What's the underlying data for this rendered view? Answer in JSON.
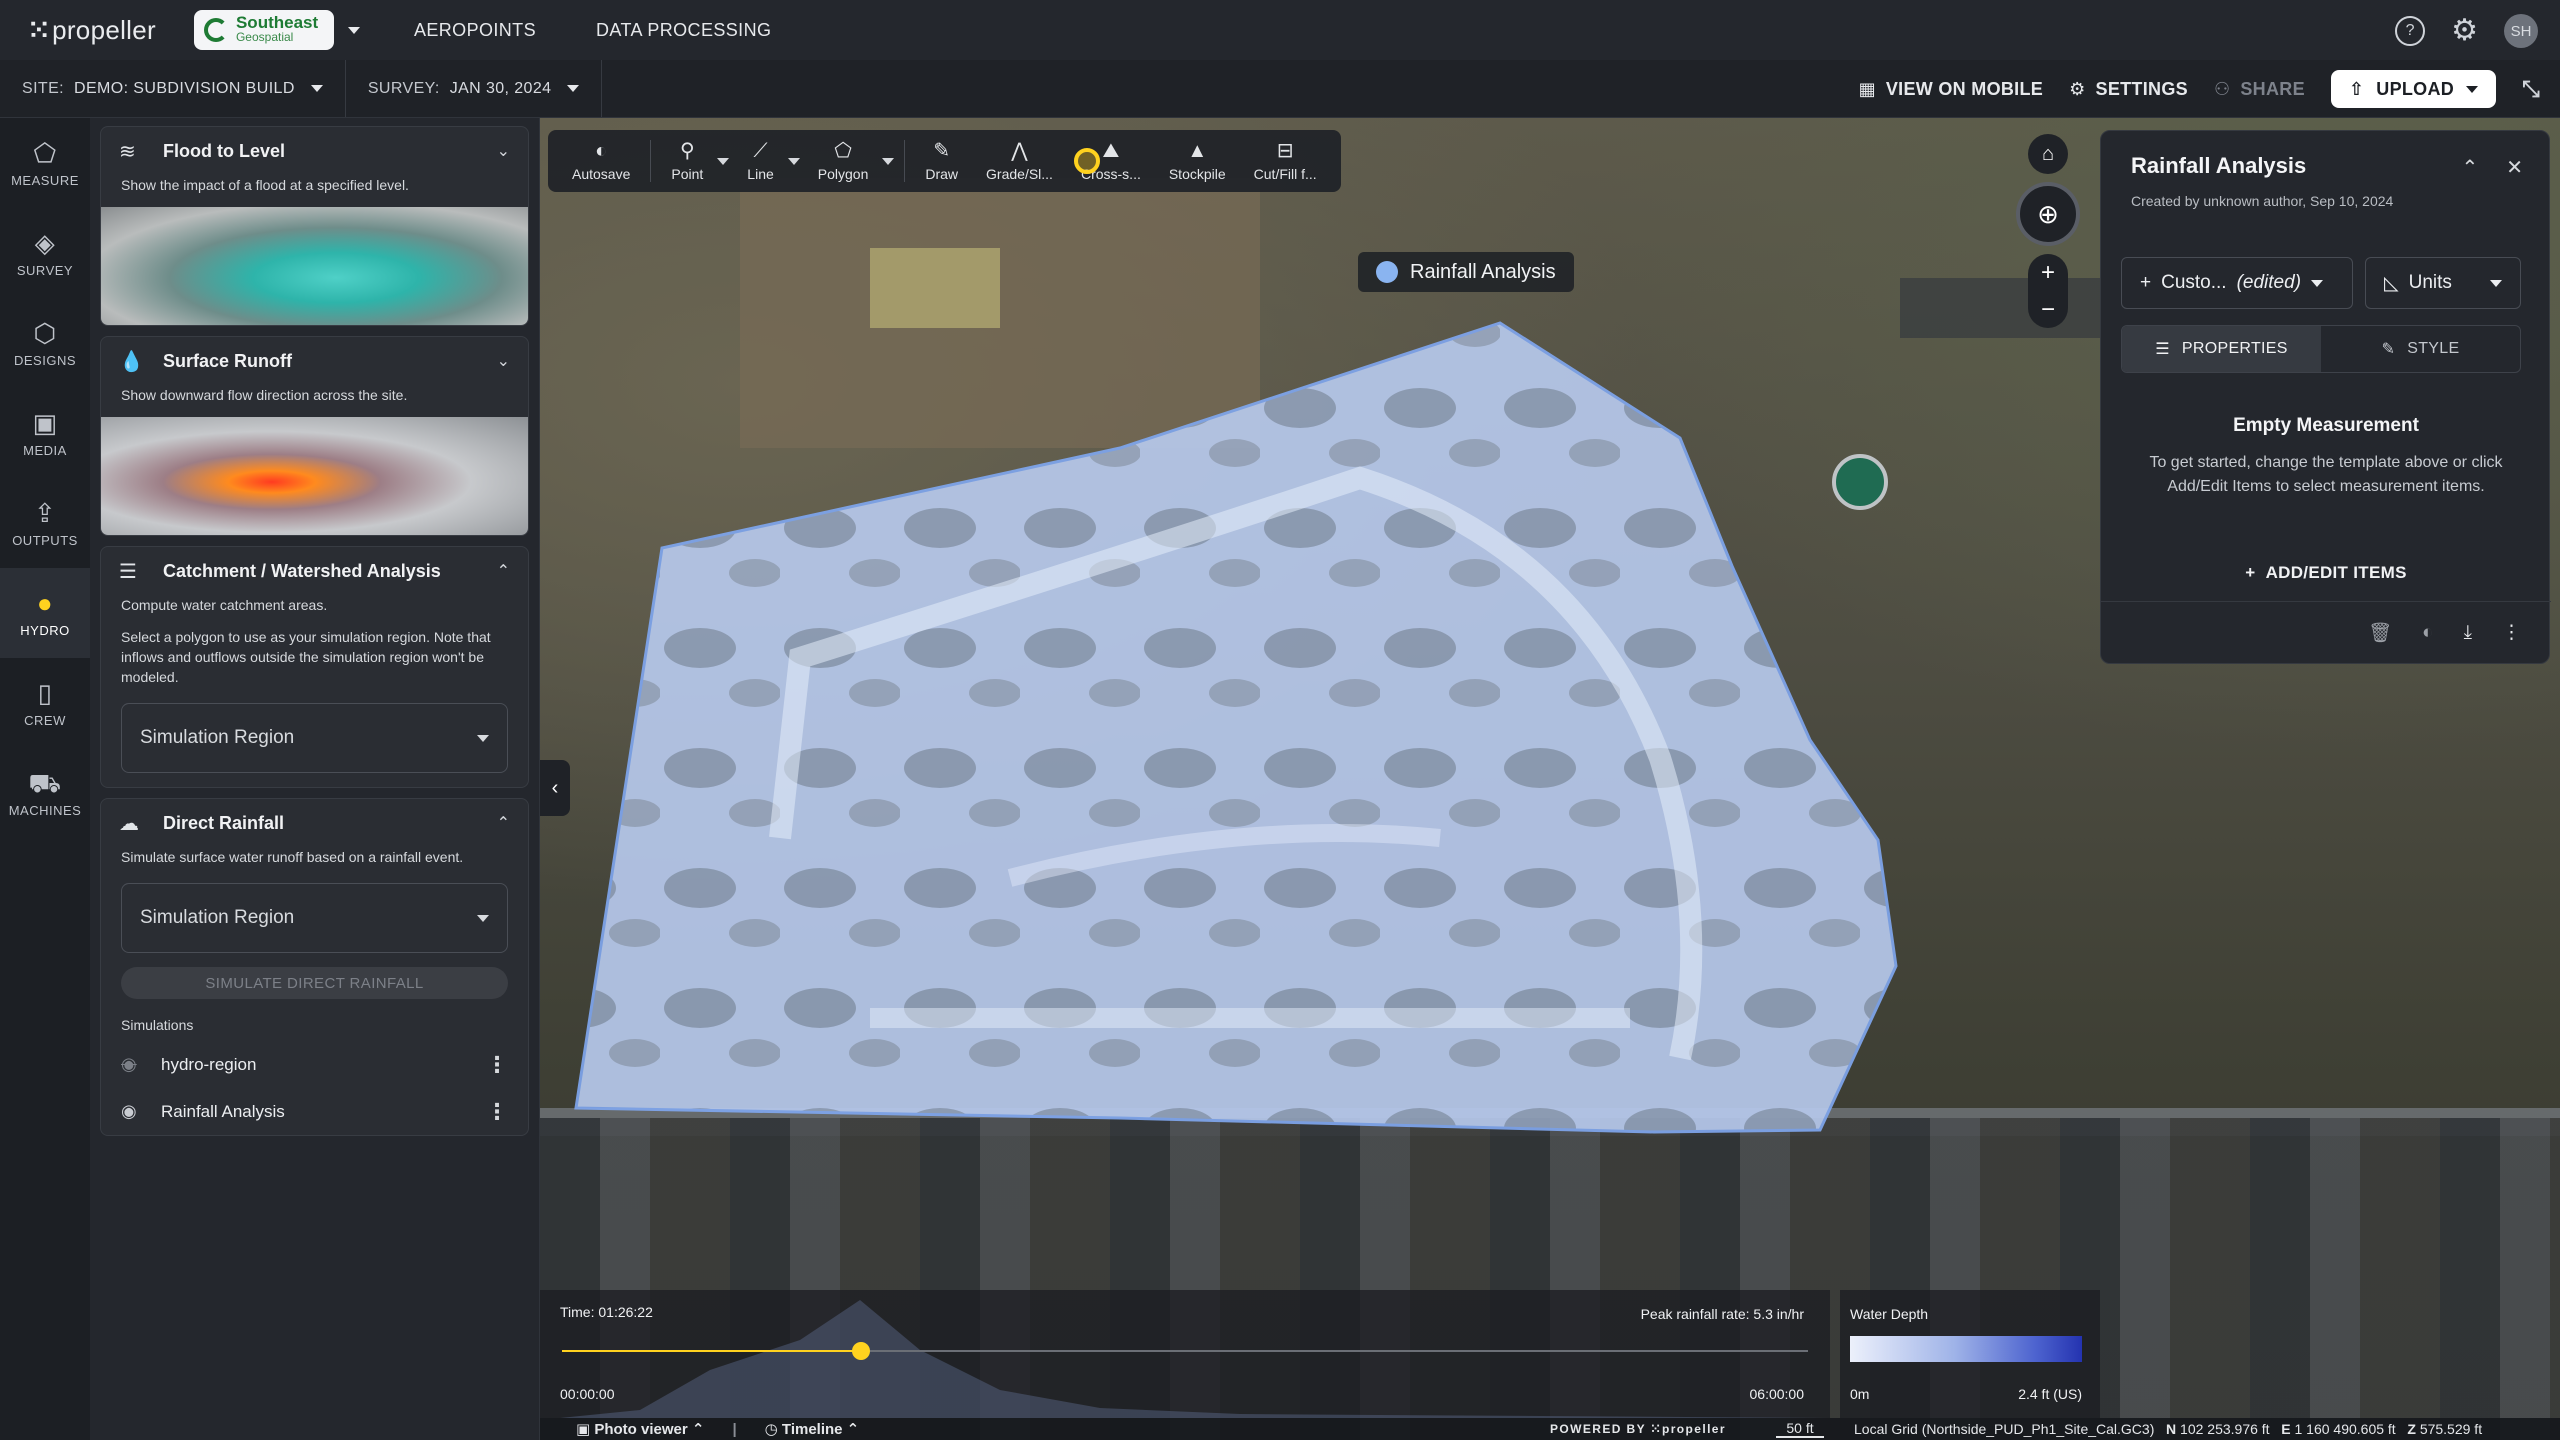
{
  "app": {
    "logo_text": "propeller",
    "org_name": "Southeast",
    "org_sub": "Geospatial",
    "nav": [
      "AEROPOINTS",
      "DATA PROCESSING"
    ],
    "avatar": "SH"
  },
  "subbar": {
    "site_label": "SITE:",
    "site_value": "DEMO: SUBDIVISION BUILD",
    "survey_label": "SURVEY:",
    "survey_value": "JAN 30, 2024",
    "view_mobile": "VIEW ON MOBILE",
    "settings": "SETTINGS",
    "share": "SHARE",
    "upload": "UPLOAD"
  },
  "rail": [
    {
      "label": "MEASURE",
      "icon": "measure-icon",
      "glyph": "⬠"
    },
    {
      "label": "SURVEY",
      "icon": "layers-icon",
      "glyph": "◈"
    },
    {
      "label": "DESIGNS",
      "icon": "cube-icon",
      "glyph": "⬡"
    },
    {
      "label": "MEDIA",
      "icon": "image-icon",
      "glyph": "▣"
    },
    {
      "label": "OUTPUTS",
      "icon": "export-icon",
      "glyph": "⇪"
    },
    {
      "label": "HYDRO",
      "icon": "water-drop-icon",
      "glyph": "●"
    },
    {
      "label": "CREW",
      "icon": "mobile-icon",
      "glyph": "▯"
    },
    {
      "label": "MACHINES",
      "icon": "machine-icon",
      "glyph": "⛟"
    }
  ],
  "panel": {
    "flood": {
      "title": "Flood to Level",
      "desc": "Show the impact of a flood at a specified level."
    },
    "runoff": {
      "title": "Surface Runoff",
      "desc": "Show downward flow direction across the site."
    },
    "catchment": {
      "title": "Catchment / Watershed Analysis",
      "desc1": "Compute water catchment areas.",
      "desc2": "Select a polygon to use as your simulation region. Note that inflows and outflows outside the simulation region won't be modeled.",
      "select": "Simulation Region"
    },
    "rainfall": {
      "title": "Direct Rainfall",
      "desc": "Simulate surface water runoff based on a rainfall event.",
      "select": "Simulation Region",
      "button": "SIMULATE DIRECT RAINFALL",
      "sims_label": "Simulations",
      "sims": [
        {
          "name": "hydro-region",
          "visible": false
        },
        {
          "name": "Rainfall Analysis",
          "visible": true
        }
      ]
    }
  },
  "toolbar": {
    "tools": [
      "Autosave",
      "Point",
      "Line",
      "Polygon",
      "Draw",
      "Grade/Sl...",
      "Cross-s...",
      "Stockpile",
      "Cut/Fill f..."
    ]
  },
  "map": {
    "feature_label": "Rainfall Analysis"
  },
  "right_panel": {
    "title": "Rainfall Analysis",
    "subtitle": "Created by unknown author, Sep 10, 2024",
    "template_select": "Custo...",
    "template_edited": "(edited)",
    "units_select": "Units",
    "tab_properties": "PROPERTIES",
    "tab_style": "STYLE",
    "empty_title": "Empty Measurement",
    "empty_desc": "To get started, change the template above or click Add/Edit Items to select measurement items.",
    "add_items": "ADD/EDIT ITEMS"
  },
  "timeline": {
    "time": "Time: 01:26:22",
    "peak": "Peak rainfall rate: 5.3 in/hr",
    "start": "00:00:00",
    "end": "06:00:00",
    "progress": 0.24
  },
  "legend": {
    "title": "Water Depth",
    "min": "0m",
    "max": "2.4 ft (US)",
    "colors": [
      "#ecf0fb",
      "#9fb3e8",
      "#4d63cf",
      "#2433b0"
    ]
  },
  "status": {
    "photo_viewer": "Photo viewer",
    "timeline": "Timeline",
    "powered_by": "POWERED BY",
    "powered_brand": "propeller",
    "scale": "50 ft",
    "grid": "Local Grid (Northside_PUD_Ph1_Site_Cal.GC3)",
    "n_label": "N",
    "n_value": "102 253.976 ft",
    "e_label": "E",
    "e_value": "1 160 490.605 ft",
    "z_label": "Z",
    "z_value": "575.529 ft"
  },
  "colors": {
    "accent": "#ffd21f",
    "water": "#a9c4ef",
    "panel_bg": "#24272d"
  }
}
